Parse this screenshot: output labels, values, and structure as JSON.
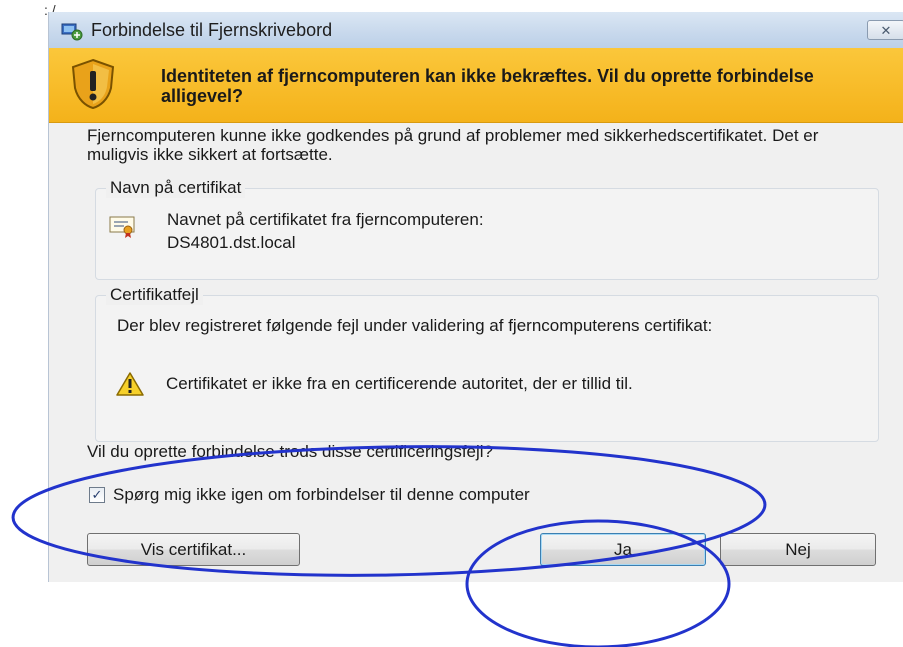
{
  "page_mark": ": /",
  "window": {
    "title": "Forbindelse til Fjernskrivebord",
    "close_label": "✕"
  },
  "warning": {
    "heading": "Identiteten af fjerncomputeren kan ikke bekræftes. Vil du oprette forbindelse alligevel?"
  },
  "description": "Fjerncomputeren kunne ikke godkendes på grund af problemer med sikkerhedscertifikatet. Det er muligvis ikke sikkert at fortsætte.",
  "cert_name_group": {
    "legend": "Navn på certifikat",
    "line1": "Navnet på certifikatet fra fjerncomputeren:",
    "line2": "DS4801.dst.local"
  },
  "cert_error_group": {
    "legend": "Certifikatfejl",
    "text": "Der blev registreret følgende fejl under validering af fjerncomputerens certifikat:",
    "detail": "Certifikatet er ikke fra en certificerende autoritet, der er tillid til."
  },
  "question": "Vil du oprette forbindelse trods disse certificeringsfejl?",
  "dont_ask_checkbox": {
    "label": "Spørg mig ikke igen om forbindelser til denne computer",
    "checked": true,
    "check_glyph": "✓"
  },
  "buttons": {
    "view_cert": "Vis certifikat...",
    "yes": "Ja",
    "no": "Nej"
  },
  "colors": {
    "annotation": "#2233cc",
    "warning_band": "#f6b92a",
    "titlebar": "#c7d8ec"
  },
  "icons": [
    "remote-desktop-icon",
    "close-icon",
    "shield-warning-icon",
    "certificate-icon",
    "warning-triangle-icon",
    "checkmark-icon"
  ]
}
